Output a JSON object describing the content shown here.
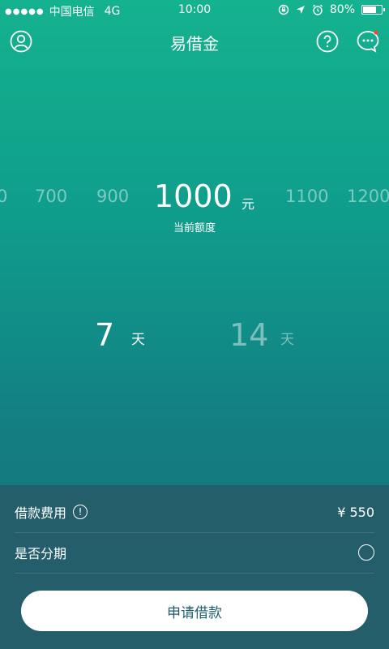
{
  "status_bar": {
    "signal_dots": "●●●●●",
    "carrier": "中国电信",
    "network": "4G",
    "time": "10:00",
    "battery": "80%",
    "battery_level": 0.8,
    "icons": [
      "lock-rotation-icon",
      "location-arrow-icon",
      "alarm-icon",
      "battery-icon"
    ]
  },
  "nav": {
    "title": "易借金",
    "icons": [
      "profile-icon",
      "help-icon",
      "message-icon"
    ],
    "message_badge_color": "#e74c3c"
  },
  "amount": {
    "options": [
      "0",
      "700",
      "900",
      "1000",
      "1100",
      "1200"
    ],
    "current": "1000",
    "unit": "元",
    "caption": "当前额度"
  },
  "days": {
    "options": [
      {
        "value": "7",
        "unit": "天",
        "selected": true
      },
      {
        "value": "14",
        "unit": "天",
        "selected": false
      }
    ]
  },
  "fee": {
    "label": "借款费用",
    "value": "¥ 550",
    "info_icon": "info-icon"
  },
  "installment": {
    "label": "是否分期",
    "radio_icon": "radio-icon"
  },
  "apply_button": {
    "label": "申请借款"
  },
  "colors": {
    "gradient_top": "#14b28f",
    "gradient_bottom": "#1a6b7a",
    "panel": "#245e6b",
    "button_text": "#1f5e6c"
  }
}
